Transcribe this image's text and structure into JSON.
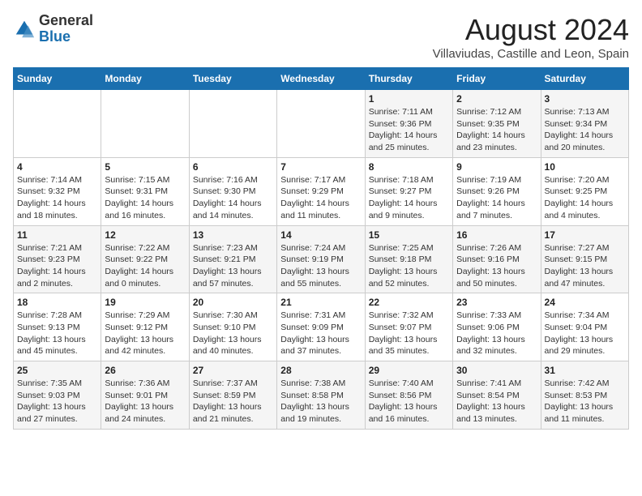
{
  "header": {
    "logo_general": "General",
    "logo_blue": "Blue",
    "month_year": "August 2024",
    "location": "Villaviudas, Castille and Leon, Spain"
  },
  "columns": [
    "Sunday",
    "Monday",
    "Tuesday",
    "Wednesday",
    "Thursday",
    "Friday",
    "Saturday"
  ],
  "weeks": [
    [
      {
        "day": "",
        "info": ""
      },
      {
        "day": "",
        "info": ""
      },
      {
        "day": "",
        "info": ""
      },
      {
        "day": "",
        "info": ""
      },
      {
        "day": "1",
        "info": "Sunrise: 7:11 AM\nSunset: 9:36 PM\nDaylight: 14 hours\nand 25 minutes."
      },
      {
        "day": "2",
        "info": "Sunrise: 7:12 AM\nSunset: 9:35 PM\nDaylight: 14 hours\nand 23 minutes."
      },
      {
        "day": "3",
        "info": "Sunrise: 7:13 AM\nSunset: 9:34 PM\nDaylight: 14 hours\nand 20 minutes."
      }
    ],
    [
      {
        "day": "4",
        "info": "Sunrise: 7:14 AM\nSunset: 9:32 PM\nDaylight: 14 hours\nand 18 minutes."
      },
      {
        "day": "5",
        "info": "Sunrise: 7:15 AM\nSunset: 9:31 PM\nDaylight: 14 hours\nand 16 minutes."
      },
      {
        "day": "6",
        "info": "Sunrise: 7:16 AM\nSunset: 9:30 PM\nDaylight: 14 hours\nand 14 minutes."
      },
      {
        "day": "7",
        "info": "Sunrise: 7:17 AM\nSunset: 9:29 PM\nDaylight: 14 hours\nand 11 minutes."
      },
      {
        "day": "8",
        "info": "Sunrise: 7:18 AM\nSunset: 9:27 PM\nDaylight: 14 hours\nand 9 minutes."
      },
      {
        "day": "9",
        "info": "Sunrise: 7:19 AM\nSunset: 9:26 PM\nDaylight: 14 hours\nand 7 minutes."
      },
      {
        "day": "10",
        "info": "Sunrise: 7:20 AM\nSunset: 9:25 PM\nDaylight: 14 hours\nand 4 minutes."
      }
    ],
    [
      {
        "day": "11",
        "info": "Sunrise: 7:21 AM\nSunset: 9:23 PM\nDaylight: 14 hours\nand 2 minutes."
      },
      {
        "day": "12",
        "info": "Sunrise: 7:22 AM\nSunset: 9:22 PM\nDaylight: 14 hours\nand 0 minutes."
      },
      {
        "day": "13",
        "info": "Sunrise: 7:23 AM\nSunset: 9:21 PM\nDaylight: 13 hours\nand 57 minutes."
      },
      {
        "day": "14",
        "info": "Sunrise: 7:24 AM\nSunset: 9:19 PM\nDaylight: 13 hours\nand 55 minutes."
      },
      {
        "day": "15",
        "info": "Sunrise: 7:25 AM\nSunset: 9:18 PM\nDaylight: 13 hours\nand 52 minutes."
      },
      {
        "day": "16",
        "info": "Sunrise: 7:26 AM\nSunset: 9:16 PM\nDaylight: 13 hours\nand 50 minutes."
      },
      {
        "day": "17",
        "info": "Sunrise: 7:27 AM\nSunset: 9:15 PM\nDaylight: 13 hours\nand 47 minutes."
      }
    ],
    [
      {
        "day": "18",
        "info": "Sunrise: 7:28 AM\nSunset: 9:13 PM\nDaylight: 13 hours\nand 45 minutes."
      },
      {
        "day": "19",
        "info": "Sunrise: 7:29 AM\nSunset: 9:12 PM\nDaylight: 13 hours\nand 42 minutes."
      },
      {
        "day": "20",
        "info": "Sunrise: 7:30 AM\nSunset: 9:10 PM\nDaylight: 13 hours\nand 40 minutes."
      },
      {
        "day": "21",
        "info": "Sunrise: 7:31 AM\nSunset: 9:09 PM\nDaylight: 13 hours\nand 37 minutes."
      },
      {
        "day": "22",
        "info": "Sunrise: 7:32 AM\nSunset: 9:07 PM\nDaylight: 13 hours\nand 35 minutes."
      },
      {
        "day": "23",
        "info": "Sunrise: 7:33 AM\nSunset: 9:06 PM\nDaylight: 13 hours\nand 32 minutes."
      },
      {
        "day": "24",
        "info": "Sunrise: 7:34 AM\nSunset: 9:04 PM\nDaylight: 13 hours\nand 29 minutes."
      }
    ],
    [
      {
        "day": "25",
        "info": "Sunrise: 7:35 AM\nSunset: 9:03 PM\nDaylight: 13 hours\nand 27 minutes."
      },
      {
        "day": "26",
        "info": "Sunrise: 7:36 AM\nSunset: 9:01 PM\nDaylight: 13 hours\nand 24 minutes."
      },
      {
        "day": "27",
        "info": "Sunrise: 7:37 AM\nSunset: 8:59 PM\nDaylight: 13 hours\nand 21 minutes."
      },
      {
        "day": "28",
        "info": "Sunrise: 7:38 AM\nSunset: 8:58 PM\nDaylight: 13 hours\nand 19 minutes."
      },
      {
        "day": "29",
        "info": "Sunrise: 7:40 AM\nSunset: 8:56 PM\nDaylight: 13 hours\nand 16 minutes."
      },
      {
        "day": "30",
        "info": "Sunrise: 7:41 AM\nSunset: 8:54 PM\nDaylight: 13 hours\nand 13 minutes."
      },
      {
        "day": "31",
        "info": "Sunrise: 7:42 AM\nSunset: 8:53 PM\nDaylight: 13 hours\nand 11 minutes."
      }
    ]
  ]
}
